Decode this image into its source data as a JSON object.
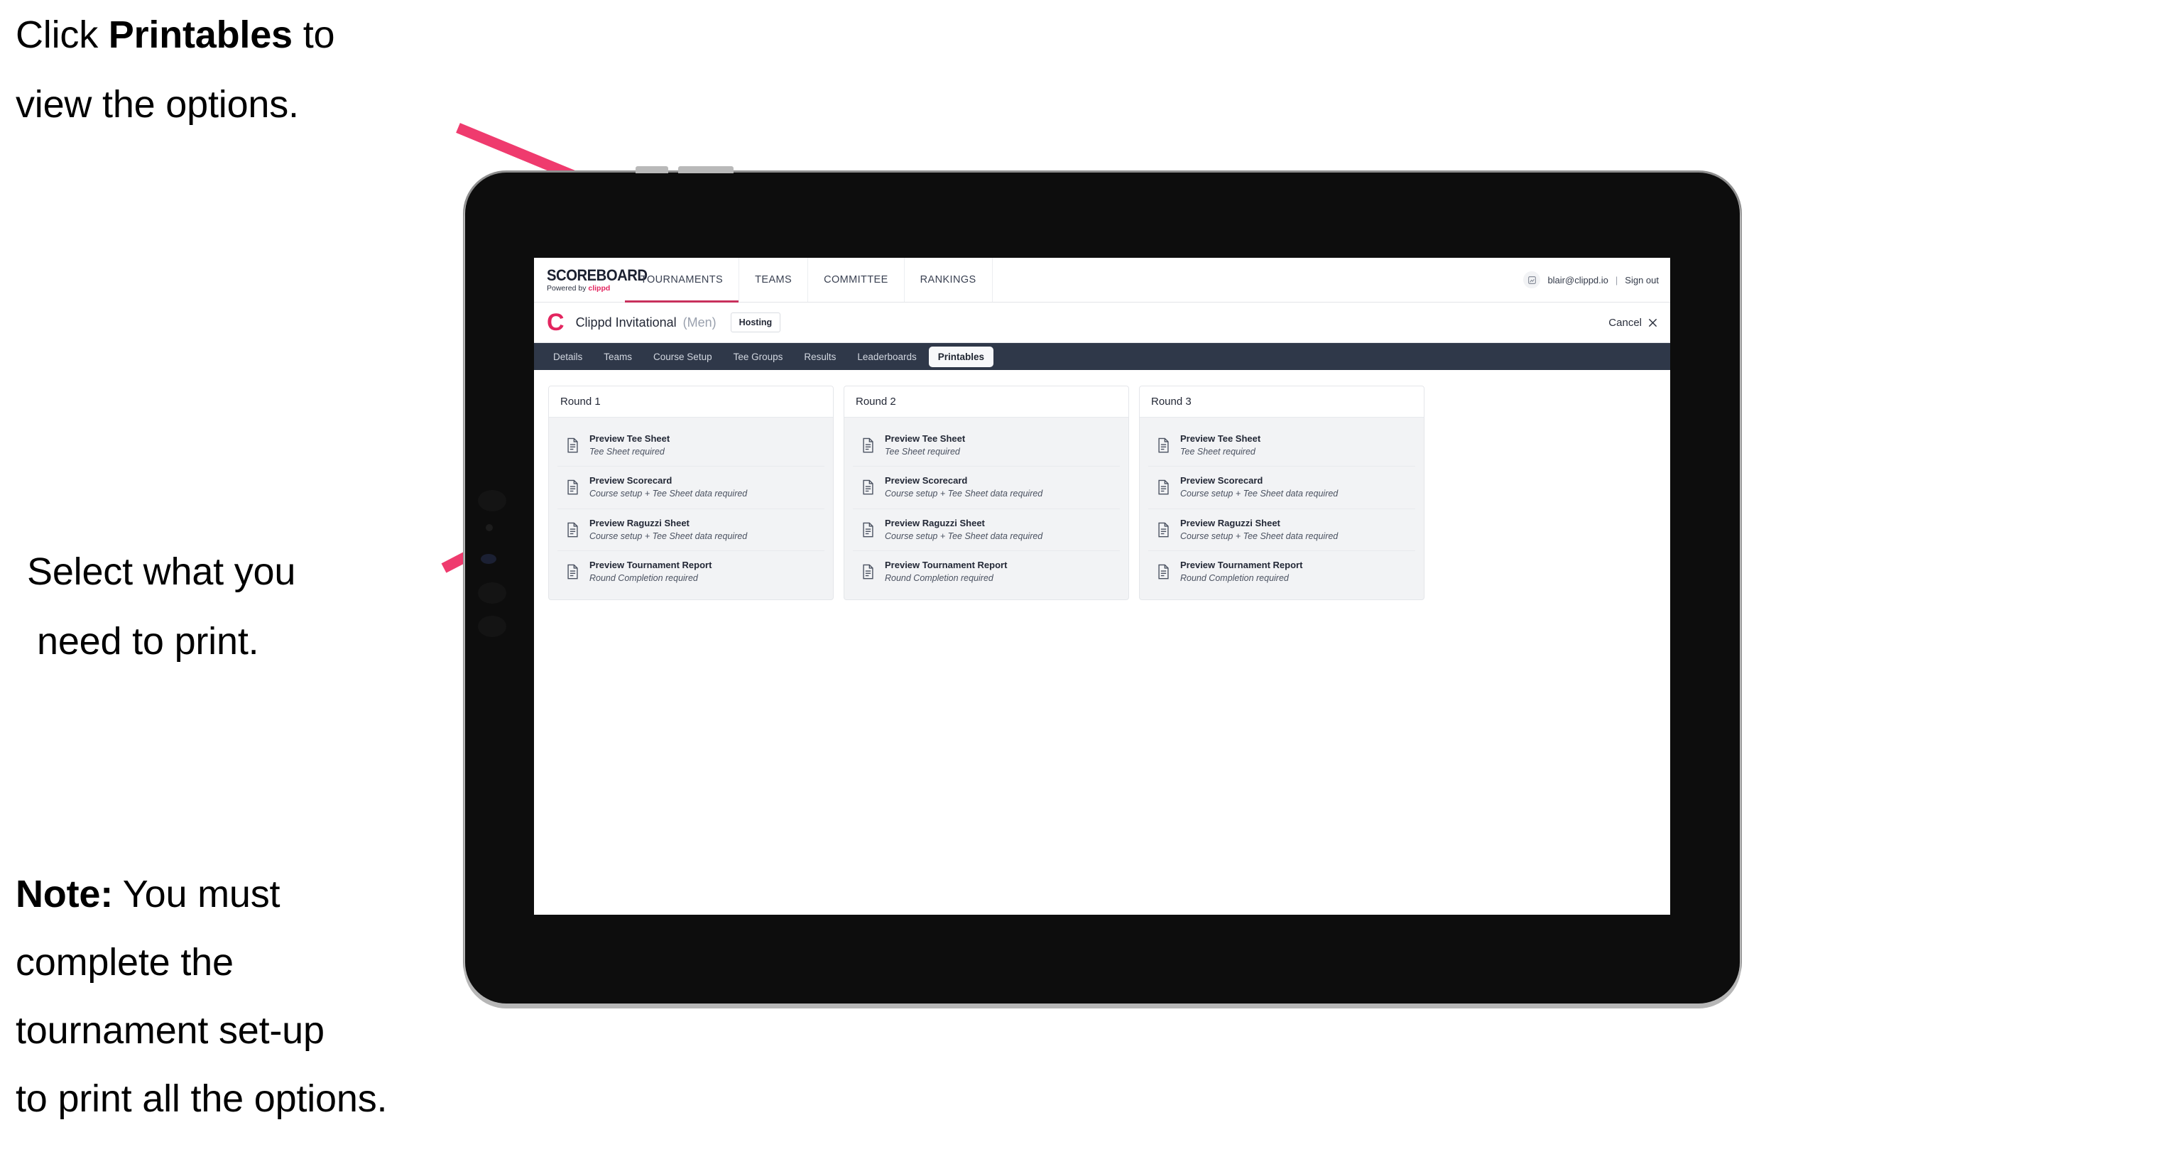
{
  "annotations": {
    "step1": {
      "pre": "Click ",
      "bold": "Printables",
      "post": " to",
      "line2": "view the options."
    },
    "step2": {
      "line1": "Select what you",
      "line2": "need to print."
    },
    "note": {
      "label": "Note:",
      "line1_rest": " You must",
      "line2": "complete the",
      "line3": "tournament set-up",
      "line4": "to print all the options."
    }
  },
  "colors": {
    "accent_pink": "#e3255f",
    "arrow_pink": "#ef3b6e",
    "navbar_dark": "#2f3849",
    "active_underline": "#c8315c"
  },
  "app": {
    "brand": {
      "title": "SCOREBOARD",
      "powered_prefix": "Powered by ",
      "powered_name": "clippd"
    },
    "topnav": {
      "items": [
        {
          "label": "TOURNAMENTS",
          "active": true
        },
        {
          "label": "TEAMS",
          "active": false
        },
        {
          "label": "COMMITTEE",
          "active": false
        },
        {
          "label": "RANKINGS",
          "active": false
        }
      ],
      "user_email": "blair@clippd.io",
      "separator": "|",
      "signout": "Sign out",
      "avatar_icon": "user-avatar-icon"
    },
    "tournament_bar": {
      "logo_letter": "C",
      "name": "Clippd Invitational",
      "gender": "(Men)",
      "badge": "Hosting",
      "cancel_label": "Cancel",
      "cancel_icon": "close-icon"
    },
    "subtabs": [
      {
        "label": "Details",
        "active": false
      },
      {
        "label": "Teams",
        "active": false
      },
      {
        "label": "Course Setup",
        "active": false
      },
      {
        "label": "Tee Groups",
        "active": false
      },
      {
        "label": "Results",
        "active": false
      },
      {
        "label": "Leaderboards",
        "active": false
      },
      {
        "label": "Printables",
        "active": true
      }
    ],
    "rounds": [
      {
        "header": "Round 1",
        "items": [
          {
            "title": "Preview Tee Sheet",
            "sub": "Tee Sheet required"
          },
          {
            "title": "Preview Scorecard",
            "sub": "Course setup + Tee Sheet data required"
          },
          {
            "title": "Preview Raguzzi Sheet",
            "sub": "Course setup + Tee Sheet data required"
          },
          {
            "title": "Preview Tournament Report",
            "sub": "Round Completion required"
          }
        ]
      },
      {
        "header": "Round 2",
        "items": [
          {
            "title": "Preview Tee Sheet",
            "sub": "Tee Sheet required"
          },
          {
            "title": "Preview Scorecard",
            "sub": "Course setup + Tee Sheet data required"
          },
          {
            "title": "Preview Raguzzi Sheet",
            "sub": "Course setup + Tee Sheet data required"
          },
          {
            "title": "Preview Tournament Report",
            "sub": "Round Completion required"
          }
        ]
      },
      {
        "header": "Round 3",
        "items": [
          {
            "title": "Preview Tee Sheet",
            "sub": "Tee Sheet required"
          },
          {
            "title": "Preview Scorecard",
            "sub": "Course setup + Tee Sheet data required"
          },
          {
            "title": "Preview Raguzzi Sheet",
            "sub": "Course setup + Tee Sheet data required"
          },
          {
            "title": "Preview Tournament Report",
            "sub": "Round Completion required"
          }
        ]
      }
    ]
  }
}
